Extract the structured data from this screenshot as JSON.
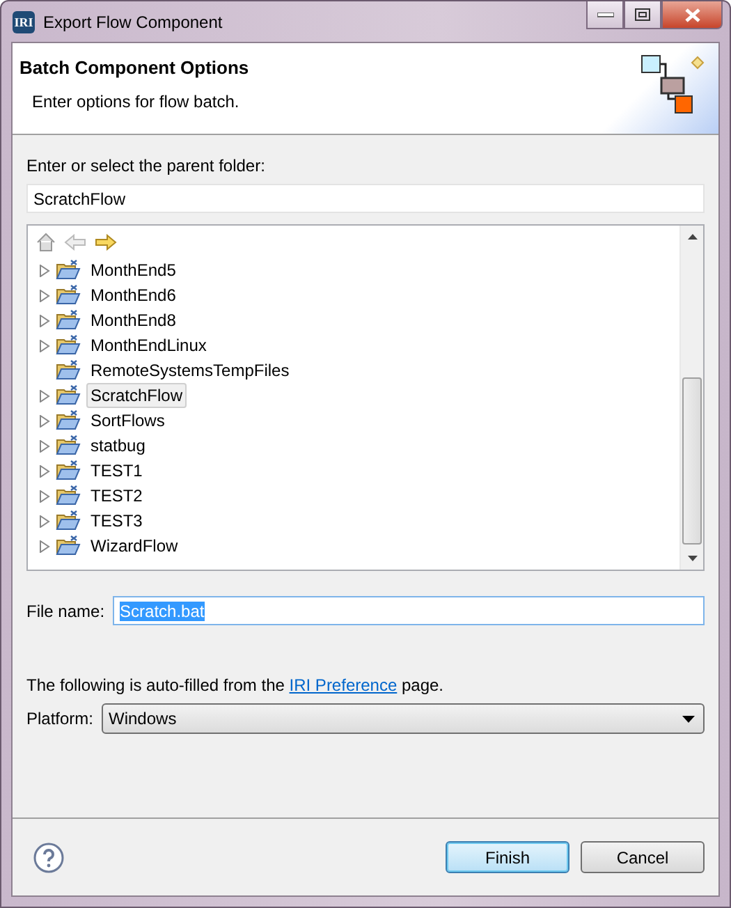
{
  "window": {
    "title": "Export Flow Component",
    "logo": "IRI"
  },
  "header": {
    "title": "Batch Component Options",
    "description": "Enter options for flow batch."
  },
  "folder": {
    "label": "Enter or select the parent folder:",
    "value": "ScratchFlow"
  },
  "tree": {
    "items": [
      {
        "label": "MonthEnd5",
        "expandable": true,
        "selected": false
      },
      {
        "label": "MonthEnd6",
        "expandable": true,
        "selected": false
      },
      {
        "label": "MonthEnd8",
        "expandable": true,
        "selected": false
      },
      {
        "label": "MonthEndLinux",
        "expandable": true,
        "selected": false
      },
      {
        "label": "RemoteSystemsTempFiles",
        "expandable": false,
        "selected": false
      },
      {
        "label": "ScratchFlow",
        "expandable": true,
        "selected": true
      },
      {
        "label": "SortFlows",
        "expandable": true,
        "selected": false
      },
      {
        "label": "statbug",
        "expandable": true,
        "selected": false
      },
      {
        "label": "TEST1",
        "expandable": true,
        "selected": false
      },
      {
        "label": "TEST2",
        "expandable": true,
        "selected": false
      },
      {
        "label": "TEST3",
        "expandable": true,
        "selected": false
      },
      {
        "label": "WizardFlow",
        "expandable": true,
        "selected": false
      }
    ]
  },
  "file_name": {
    "label": "File name:",
    "value": "Scratch.bat"
  },
  "info": {
    "before": "The following is auto-filled from the",
    "link": "IRI Preference",
    "after": "page."
  },
  "platform": {
    "label": "Platform:",
    "value": "Windows"
  },
  "buttons": [
    {
      "label": "Finish",
      "default": true
    },
    {
      "label": "Cancel",
      "default": false
    }
  ]
}
